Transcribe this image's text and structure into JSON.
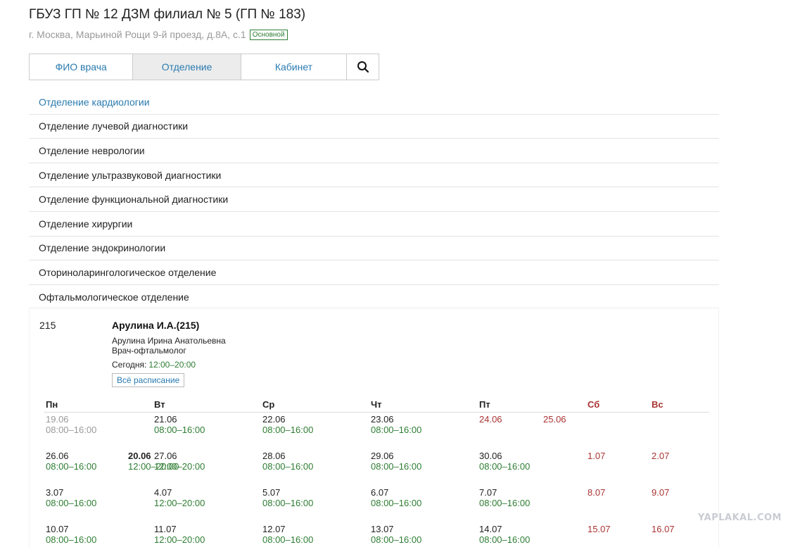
{
  "page": {
    "title": "ГБУЗ ГП № 12 ДЗМ филиал № 5 (ГП № 183)",
    "address": "г. Москва, Марьиной Рощи 9-й проезд, д.8А, с.1",
    "badge": "Основной"
  },
  "tabs": [
    {
      "label": "ФИО врача",
      "active": false
    },
    {
      "label": "Отделение",
      "active": true
    },
    {
      "label": "Кабинет",
      "active": false
    }
  ],
  "departments": [
    "Отделение кардиологии",
    "Отделение лучевой диагностики",
    "Отделение неврологии",
    "Отделение ультразвуковой диагностики",
    "Отделение функциональной диагностики",
    "Отделение хирургии",
    "Отделение эндокринологии",
    "Оториноларингологическое отделение",
    "Офтальмологическое отделение"
  ],
  "doctor": {
    "cabinet": "215",
    "short_name": "Арулина И.А.(215)",
    "full_name": "Арулина Ирина Анатольевна",
    "specialty": "Врач-офтальмолог",
    "today_label": "Сегодня:",
    "today_hours": "12:00–20:00",
    "all_schedule_label": "Всё расписание"
  },
  "schedule": {
    "days": [
      "Пн",
      "Вт",
      "Ср",
      "Чт",
      "Пт",
      "Сб",
      "Вс"
    ],
    "weeks": [
      [
        {
          "date": "19.06",
          "hours": "08:00–16:00",
          "state": "past"
        },
        {
          "date": "20.06",
          "hours": "12:00–20:00",
          "state": "today"
        },
        {
          "date": "21.06",
          "hours": "08:00–16:00",
          "state": "work"
        },
        {
          "date": "22.06",
          "hours": "08:00–16:00",
          "state": "work"
        },
        {
          "date": "23.06",
          "hours": "08:00–16:00",
          "state": "work"
        },
        {
          "date": "24.06",
          "hours": "",
          "state": "weekend"
        },
        {
          "date": "25.06",
          "hours": "",
          "state": "weekend"
        }
      ],
      [
        {
          "date": "26.06",
          "hours": "08:00–16:00",
          "state": "work"
        },
        {
          "date": "27.06",
          "hours": "12:00–20:00",
          "state": "work"
        },
        {
          "date": "28.06",
          "hours": "08:00–16:00",
          "state": "work"
        },
        {
          "date": "29.06",
          "hours": "08:00–16:00",
          "state": "work"
        },
        {
          "date": "30.06",
          "hours": "08:00–16:00",
          "state": "work"
        },
        {
          "date": "1.07",
          "hours": "",
          "state": "weekend"
        },
        {
          "date": "2.07",
          "hours": "",
          "state": "weekend"
        }
      ],
      [
        {
          "date": "3.07",
          "hours": "08:00–16:00",
          "state": "work"
        },
        {
          "date": "4.07",
          "hours": "12:00–20:00",
          "state": "work"
        },
        {
          "date": "5.07",
          "hours": "08:00–16:00",
          "state": "work"
        },
        {
          "date": "6.07",
          "hours": "08:00–16:00",
          "state": "work"
        },
        {
          "date": "7.07",
          "hours": "08:00–16:00",
          "state": "work"
        },
        {
          "date": "8.07",
          "hours": "",
          "state": "weekend"
        },
        {
          "date": "9.07",
          "hours": "",
          "state": "weekend"
        }
      ],
      [
        {
          "date": "10.07",
          "hours": "08:00–16:00",
          "state": "work"
        },
        {
          "date": "11.07",
          "hours": "12:00–20:00",
          "state": "work"
        },
        {
          "date": "12.07",
          "hours": "08:00–16:00",
          "state": "work"
        },
        {
          "date": "13.07",
          "hours": "08:00–16:00",
          "state": "work"
        },
        {
          "date": "14.07",
          "hours": "08:00–16:00",
          "state": "work"
        },
        {
          "date": "15.07",
          "hours": "",
          "state": "weekend"
        },
        {
          "date": "16.07",
          "hours": "",
          "state": "weekend"
        }
      ]
    ]
  },
  "watermark": "YAPLAKAL.COM",
  "icons": {
    "search": "search-icon"
  },
  "colors": {
    "link": "#2a7bb0",
    "hours": "#2e7d32",
    "weekend": "#a33333",
    "past": "#999999"
  }
}
